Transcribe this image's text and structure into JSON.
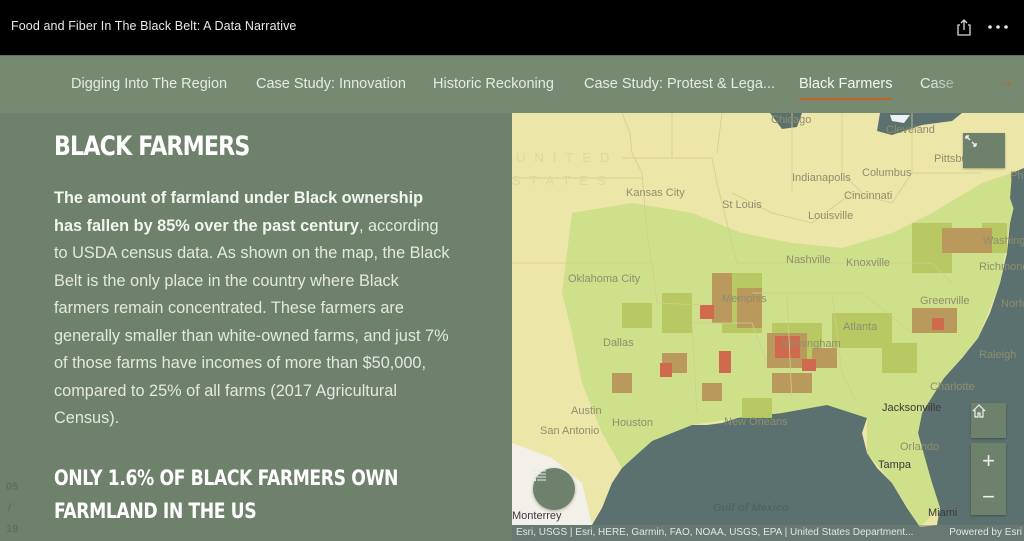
{
  "app": {
    "title": "Food and Fiber In The Black Belt: A Data Narrative",
    "share_icon": "share-icon",
    "more_icon": "more-options-icon"
  },
  "nav": {
    "tabs": [
      {
        "label": "Digging Into The Region",
        "active": false
      },
      {
        "label": "Case Study: Innovation",
        "active": false
      },
      {
        "label": "Historic Reckoning",
        "active": false
      },
      {
        "label": "Case Study: Protest & Lega...",
        "active": false
      },
      {
        "label": "Black Farmers",
        "active": true
      },
      {
        "label": "Case",
        "active": false
      }
    ],
    "next_arrow": "→",
    "accent_color": "#c8602a"
  },
  "panel": {
    "heading": "BLACK FARMERS",
    "lead": "The amount of farmland under Black ownership has fallen by 85% over the past century",
    "body": ", according to USDA census data. As shown on the map, the Black Belt is the only place in the country where Black farmers remain concentrated. These farmers are generally smaller than white-owned farms, and just 7% of those farms have incomes of more than $50,000, compared to 25% of all farms (2017 Agricultural Census).",
    "subheading": "ONLY 1.6% OF BLACK FARMERS OWN FARMLAND IN THE US",
    "pager": {
      "current": "05",
      "separator": "/",
      "total": "19"
    }
  },
  "map": {
    "country_label_1": "UNITED",
    "country_label_2": "STATES",
    "cities": [
      {
        "name": "Chicago"
      },
      {
        "name": "Cleveland"
      },
      {
        "name": "Pittsburgh"
      },
      {
        "name": "Indianapolis"
      },
      {
        "name": "Columbus"
      },
      {
        "name": "Cincinnati"
      },
      {
        "name": "Louisville"
      },
      {
        "name": "Kansas City"
      },
      {
        "name": "St Louis"
      },
      {
        "name": "Washington"
      },
      {
        "name": "Richmond"
      },
      {
        "name": "Nashville"
      },
      {
        "name": "Knoxville"
      },
      {
        "name": "Raleigh"
      },
      {
        "name": "Charlotte"
      },
      {
        "name": "Greenville"
      },
      {
        "name": "Oklahoma City"
      },
      {
        "name": "Memphis"
      },
      {
        "name": "Atlanta"
      },
      {
        "name": "Birmingham"
      },
      {
        "name": "Dallas"
      },
      {
        "name": "Austin"
      },
      {
        "name": "Houston"
      },
      {
        "name": "San Antonio"
      },
      {
        "name": "New Orleans"
      },
      {
        "name": "Jacksonville"
      },
      {
        "name": "Orlando"
      },
      {
        "name": "Tampa"
      },
      {
        "name": "Miami"
      },
      {
        "name": "Monterrey"
      },
      {
        "name": "Gulf of Mexico"
      },
      {
        "name": "Philadelphia"
      },
      {
        "name": "Norfolk"
      }
    ],
    "attribution": "Esri, USGS | Esri, HERE, Garmin, FAO, NOAA, USGS, EPA | United States Department...",
    "powered_by": "Powered by Esri",
    "controls": {
      "expand_icon": "expand-icon",
      "home_icon": "home-icon",
      "zoom_in": "+",
      "zoom_out": "−",
      "legend_icon": "legend-list-icon"
    },
    "colors": {
      "water": "#5b7170",
      "land_low": "#ece6a8",
      "land_some": "#cfe08a",
      "land_mid": "#b8c863",
      "land_high": "#b99a5c",
      "land_highest": "#cf6a4e"
    }
  }
}
